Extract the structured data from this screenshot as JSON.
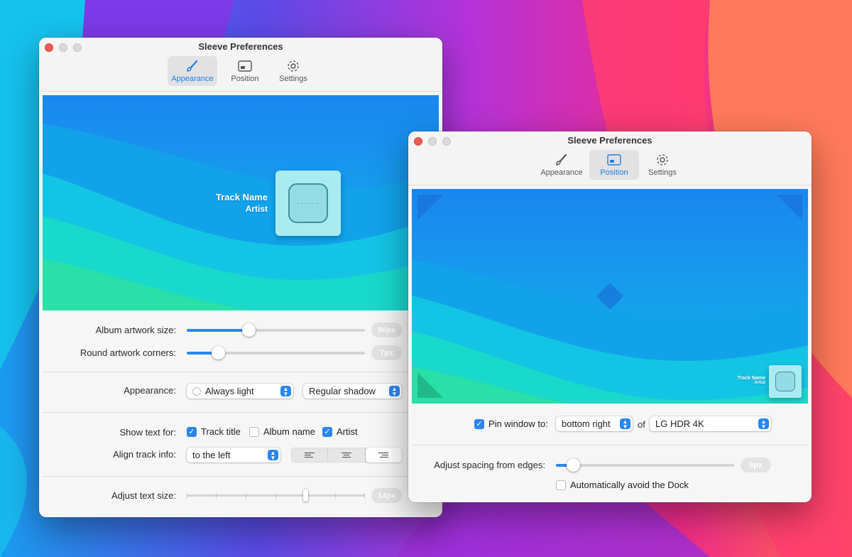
{
  "windows": {
    "appearance": {
      "title": "Sleeve Preferences",
      "toolbar": {
        "appearance": "Appearance",
        "position": "Position",
        "settings": "Settings",
        "active": "Appearance"
      },
      "preview": {
        "track_name": "Track Name",
        "artist": "Artist",
        "art_dots": "······"
      },
      "artwork_size": {
        "label": "Album artwork size:",
        "value": "96px",
        "level": 0.35
      },
      "round_corners": {
        "label": "Round artwork corners:",
        "value": "7px",
        "level": 0.18
      },
      "appearance_row": {
        "label": "Appearance:",
        "mode": "Always light",
        "shadow": "Regular shadow"
      },
      "show_text": {
        "label": "Show text for:",
        "options": [
          {
            "label": "Track title",
            "checked": true
          },
          {
            "label": "Album name",
            "checked": false
          },
          {
            "label": "Artist",
            "checked": true
          }
        ]
      },
      "align_info": {
        "label": "Align track info:",
        "value": "to the left",
        "segments": [
          "align-left",
          "align-center",
          "align-right"
        ],
        "selected": "align-right"
      },
      "text_size": {
        "label": "Adjust text size:",
        "value": "14px",
        "level": 0.67
      }
    },
    "position": {
      "title": "Sleeve Preferences",
      "toolbar": {
        "appearance": "Appearance",
        "position": "Position",
        "settings": "Settings",
        "active": "Position"
      },
      "preview": {
        "track_name": "Track Name",
        "artist": "Artist",
        "art_dots": "···"
      },
      "pin": {
        "label": "Pin window to:",
        "checked": true,
        "corner": "bottom right",
        "of_label": "of",
        "display": "LG HDR 4K"
      },
      "spacing": {
        "label": "Adjust spacing from edges:",
        "value": "8px",
        "level": 0.1
      },
      "avoid_dock": {
        "label": "Automatically avoid the Dock",
        "checked": false
      }
    }
  },
  "colors": {
    "accent": "#2a86f2",
    "close": "#ee5c55"
  }
}
